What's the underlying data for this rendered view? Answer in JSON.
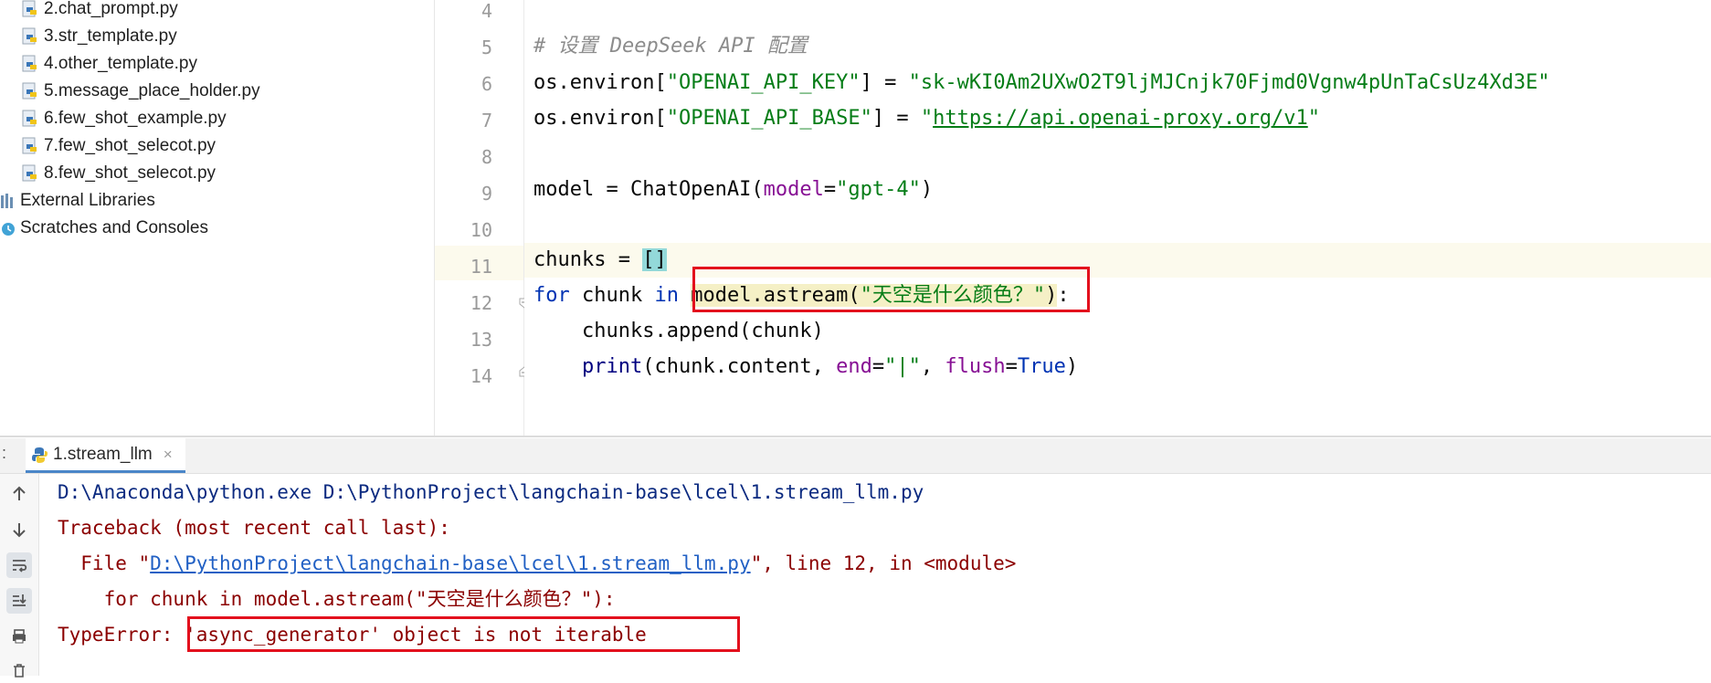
{
  "project_tree": {
    "files": [
      "2.chat_prompt.py",
      "3.str_template.py",
      "4.other_template.py",
      "5.message_place_holder.py",
      "6.few_shot_example.py",
      "7.few_shot_selecot.py",
      "8.few_shot_selecot.py"
    ],
    "external_libraries": "External Libraries",
    "scratches": "Scratches and Consoles"
  },
  "editor": {
    "line_numbers": [
      "4",
      "5",
      "6",
      "7",
      "8",
      "9",
      "10",
      "11",
      "12",
      "13",
      "14"
    ],
    "current_line": "11",
    "comment_text": "# 设置 DeepSeek API 配置",
    "os_environ": "os.environ[",
    "key_name_1": "\"OPENAI_API_KEY\"",
    "assign_1": "] = ",
    "key_value_1": "\"sk-wKI0Am2UXwO2T9ljMJCnjk70Fjmd0Vgnw4pUnTaCsUz4Xd3E\"",
    "key_name_2": "\"OPENAI_API_BASE\"",
    "assign_2": "] = ",
    "quote_open": "\"",
    "url": "https://api.openai-proxy.org/v1",
    "quote_close": "\"",
    "model_prefix": "model = ChatOpenAI(",
    "model_param": "model",
    "model_eq": "=",
    "model_value": "\"gpt-4\"",
    "model_suffix": ")",
    "chunks_prefix": "chunks = ",
    "chunks_brackets": "[]",
    "for_kw": "for",
    "chunk_var": " chunk ",
    "in_kw": "in",
    "astream_call": "model.astream(",
    "astream_arg": "\"天空是什么颜色？\"",
    "astream_close": ")",
    "for_colon": ":",
    "append_line": "    chunks.append(chunk)",
    "print_indent": "    ",
    "print_fn": "print",
    "print_args": "(chunk.content, ",
    "end_param": "end",
    "end_eq": "=",
    "end_value": "\"|\"",
    "comma_sp": ", ",
    "flush_param": "flush",
    "flush_eq": "=",
    "flush_value": "True",
    "print_close": ")"
  },
  "run_panel": {
    "tab_colon": ":",
    "tab_label": "1.stream_llm",
    "close_glyph": "×",
    "command": "D:\\Anaconda\\python.exe D:\\PythonProject\\langchain-base\\lcel\\1.stream_llm.py",
    "traceback_header": "Traceback (most recent call last):",
    "file_prefix": "  File \"",
    "file_link": "D:\\PythonProject\\langchain-base\\lcel\\1.stream_llm.py",
    "file_suffix": "\", line 12, in <module>",
    "code_echo": "    for chunk in model.astream(\"天空是什么颜色？\"):",
    "error_type": "TypeError: ",
    "error_message": "'async_generator' object is not iterable"
  },
  "toolbar_icons": [
    "arrow-up-icon",
    "arrow-down-icon",
    "soft-wrap-icon",
    "scroll-to-end-icon",
    "print-icon",
    "trash-icon"
  ],
  "colors": {
    "annotation_red": "#e3101d",
    "keyword_blue": "#0033b3",
    "string_green": "#067d17",
    "error_dark_red": "#8b0000"
  }
}
